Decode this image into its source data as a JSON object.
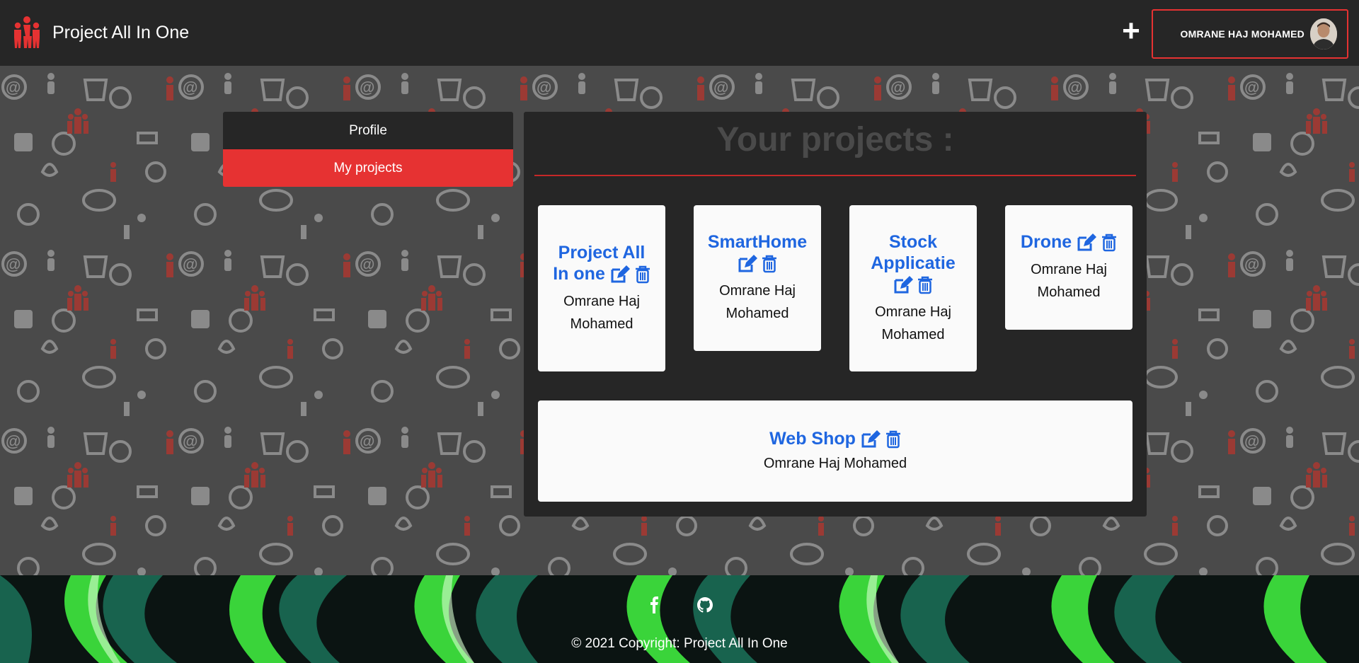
{
  "navbar": {
    "brand": "Project All In One",
    "brand_icon": "people-logo-icon",
    "add_icon": "+",
    "user_name": "OMRANE HAJ MOHAMED"
  },
  "sidenav": {
    "items": [
      {
        "label": "Profile",
        "active": false
      },
      {
        "label": "My projects",
        "active": true
      }
    ]
  },
  "main": {
    "title": "Your projects :",
    "projects": [
      {
        "name": "Project All In one",
        "owner": "Omrane Haj Mohamed"
      },
      {
        "name": "SmartHome",
        "owner": "Omrane Haj Mohamed"
      },
      {
        "name": "Stock Applicatie",
        "owner": "Omrane Haj Mohamed"
      },
      {
        "name": "Drone",
        "owner": "Omrane Haj Mohamed"
      },
      {
        "name": "Web Shop",
        "owner": "Omrane Haj Mohamed"
      }
    ]
  },
  "footer": {
    "social": [
      "facebook-icon",
      "github-icon"
    ],
    "copyright": "© 2021 Copyright: Project All In One"
  },
  "colors": {
    "accent": "#e63232",
    "link": "#1f66e0",
    "navbar": "#262626",
    "panel": "#262626"
  }
}
